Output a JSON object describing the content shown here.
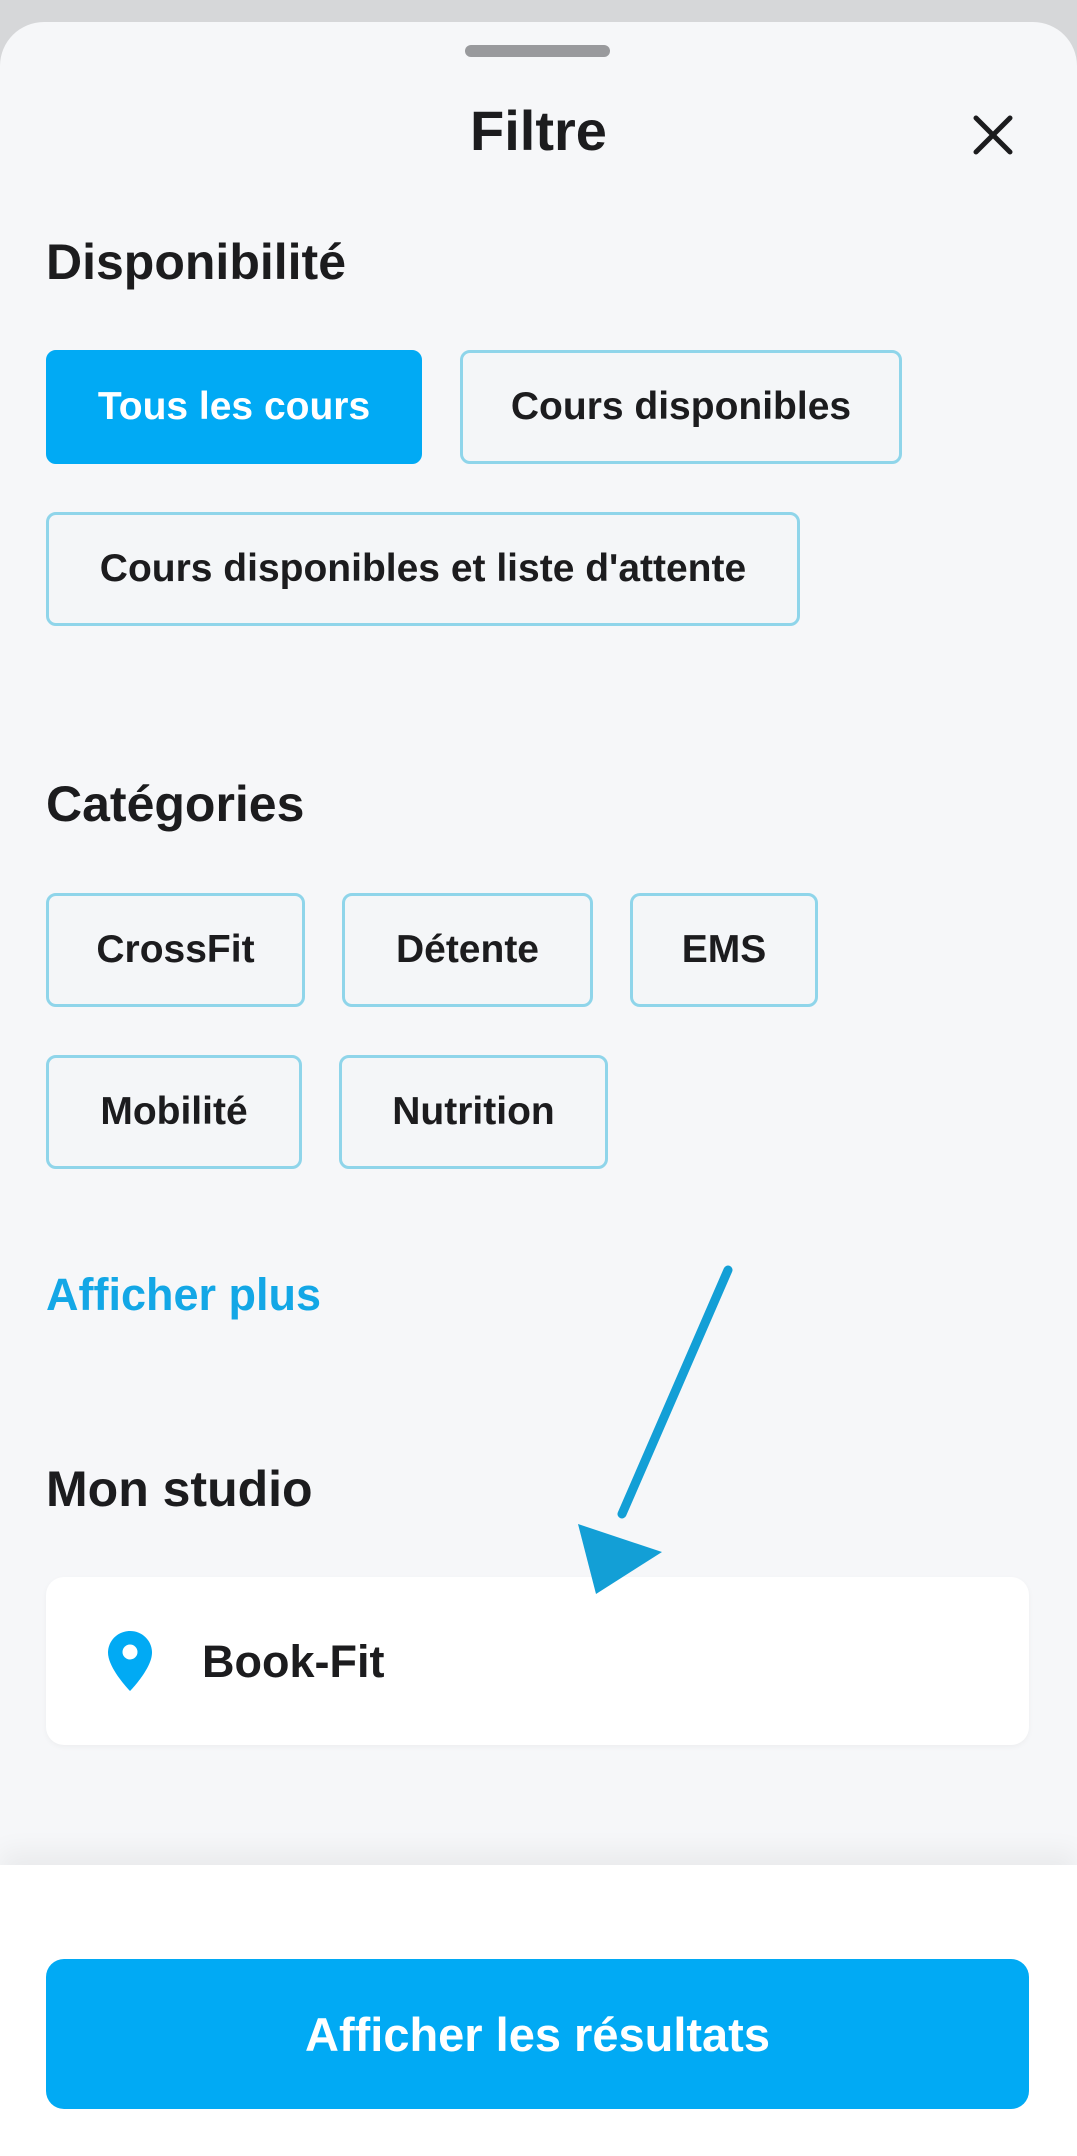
{
  "header": {
    "title": "Filtre"
  },
  "availability": {
    "title": "Disponibilité",
    "options": [
      {
        "label": "Tous les cours",
        "selected": true
      },
      {
        "label": "Cours disponibles",
        "selected": false
      },
      {
        "label": "Cours disponibles et liste d'attente",
        "selected": false
      }
    ]
  },
  "categories": {
    "title": "Catégories",
    "options": [
      {
        "label": "CrossFit",
        "selected": false
      },
      {
        "label": "Détente",
        "selected": false
      },
      {
        "label": "EMS",
        "selected": false
      },
      {
        "label": "Mobilité",
        "selected": false
      },
      {
        "label": "Nutrition",
        "selected": false
      }
    ],
    "show_more": "Afficher plus"
  },
  "studio": {
    "title": "Mon studio",
    "name": "Book-Fit",
    "icon": "location-pin-icon"
  },
  "footer": {
    "results_label": "Afficher les résultats"
  },
  "colors": {
    "accent": "#01aaf4",
    "link": "#13a7e6",
    "chip_border": "#8fd5ea",
    "annotation_arrow": "#139fd6"
  }
}
